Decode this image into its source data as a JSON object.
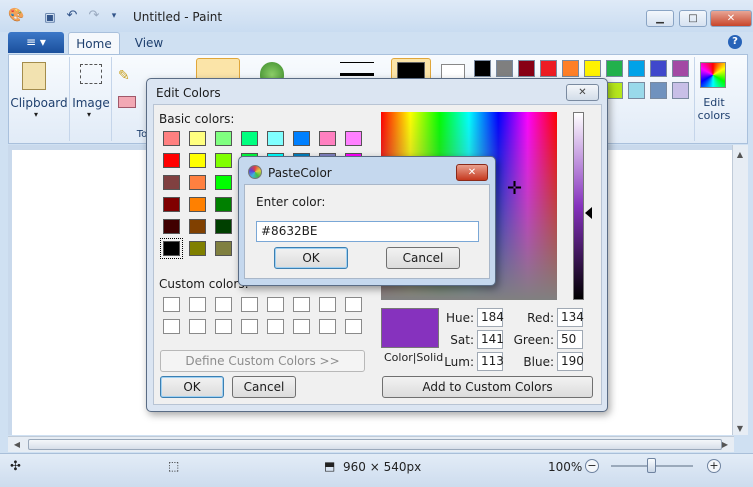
{
  "window": {
    "title": "Untitled - Paint",
    "minimize": "▁",
    "maximize": "□",
    "close": "✕"
  },
  "qat": {
    "app_icon": "paint-palette-icon",
    "save_icon": "save-icon",
    "undo_icon": "undo-icon",
    "redo_icon": "redo-icon",
    "customize_icon": "chevron-down-icon"
  },
  "ribbon": {
    "file_menu": "≡ ▾",
    "tabs": [
      "Home",
      "View"
    ],
    "help": "?",
    "groups": {
      "clipboard": "Clipboard",
      "image": "Image",
      "tools_partial": "To",
      "edit_colors": "Edit colors"
    },
    "palette": [
      "#000000",
      "#7f7f7f",
      "#880015",
      "#ed1c24",
      "#ff7f27",
      "#fff200",
      "#22b14c",
      "#00a2e8",
      "#3f48cc",
      "#a349a4",
      "#ffffff",
      "#c3c3c3",
      "#b97a57",
      "#ffaec9",
      "#ffc90e",
      "#efe4b0",
      "#b5e61d",
      "#99d9ea",
      "#7092be",
      "#c8bfe7"
    ]
  },
  "status": {
    "size": "960 × 540px",
    "zoom": "100%",
    "zoom_out": "−",
    "zoom_in": "+"
  },
  "edit_colors": {
    "title": "Edit Colors",
    "close": "✕",
    "basic_label": "Basic colors:",
    "basic_colors": [
      [
        "#ff8080",
        "#ffff80",
        "#80ff80",
        "#00ff80",
        "#80ffff",
        "#0080ff",
        "#ff80c0",
        "#ff80ff"
      ],
      [
        "#ff0000",
        "#ffff00",
        "#80ff00",
        "#00ff40",
        "#00ffff",
        "#0080c0",
        "#8080c0",
        "#ff00ff"
      ],
      [
        "#804040",
        "#ff8040",
        "#00ff00",
        "#008080",
        "#004080",
        "#8080ff",
        "#800040",
        "#ff0080"
      ],
      [
        "#800000",
        "#ff8000",
        "#008000",
        "#008040",
        "#0000ff",
        "#0000a0",
        "#800080",
        "#8000ff"
      ],
      [
        "#400000",
        "#804000",
        "#004000",
        "#004040",
        "#000080",
        "#000040",
        "#400040",
        "#400080"
      ],
      [
        "#000000",
        "#808000",
        "#808040",
        "#808080",
        "#408080",
        "#c0c0c0",
        "#400040",
        "#ffffff"
      ]
    ],
    "custom_label": "Custom colors:",
    "define_custom": "Define Custom Colors >>",
    "ok": "OK",
    "cancel": "Cancel",
    "color_solid": "Color|Solid",
    "hue_label": "Hue:",
    "hue": "184",
    "sat_label": "Sat:",
    "sat": "141",
    "lum_label": "Lum:",
    "lum": "113",
    "red_label": "Red:",
    "red": "134",
    "green_label": "Green:",
    "green": "50",
    "blue_label": "Blue:",
    "blue": "190",
    "add_custom": "Add to Custom Colors",
    "current_color": "#8632BE"
  },
  "paste_color": {
    "title": "PasteColor",
    "close": "✕",
    "prompt": "Enter color:",
    "value": "#8632BE",
    "ok": "OK",
    "cancel": "Cancel"
  }
}
